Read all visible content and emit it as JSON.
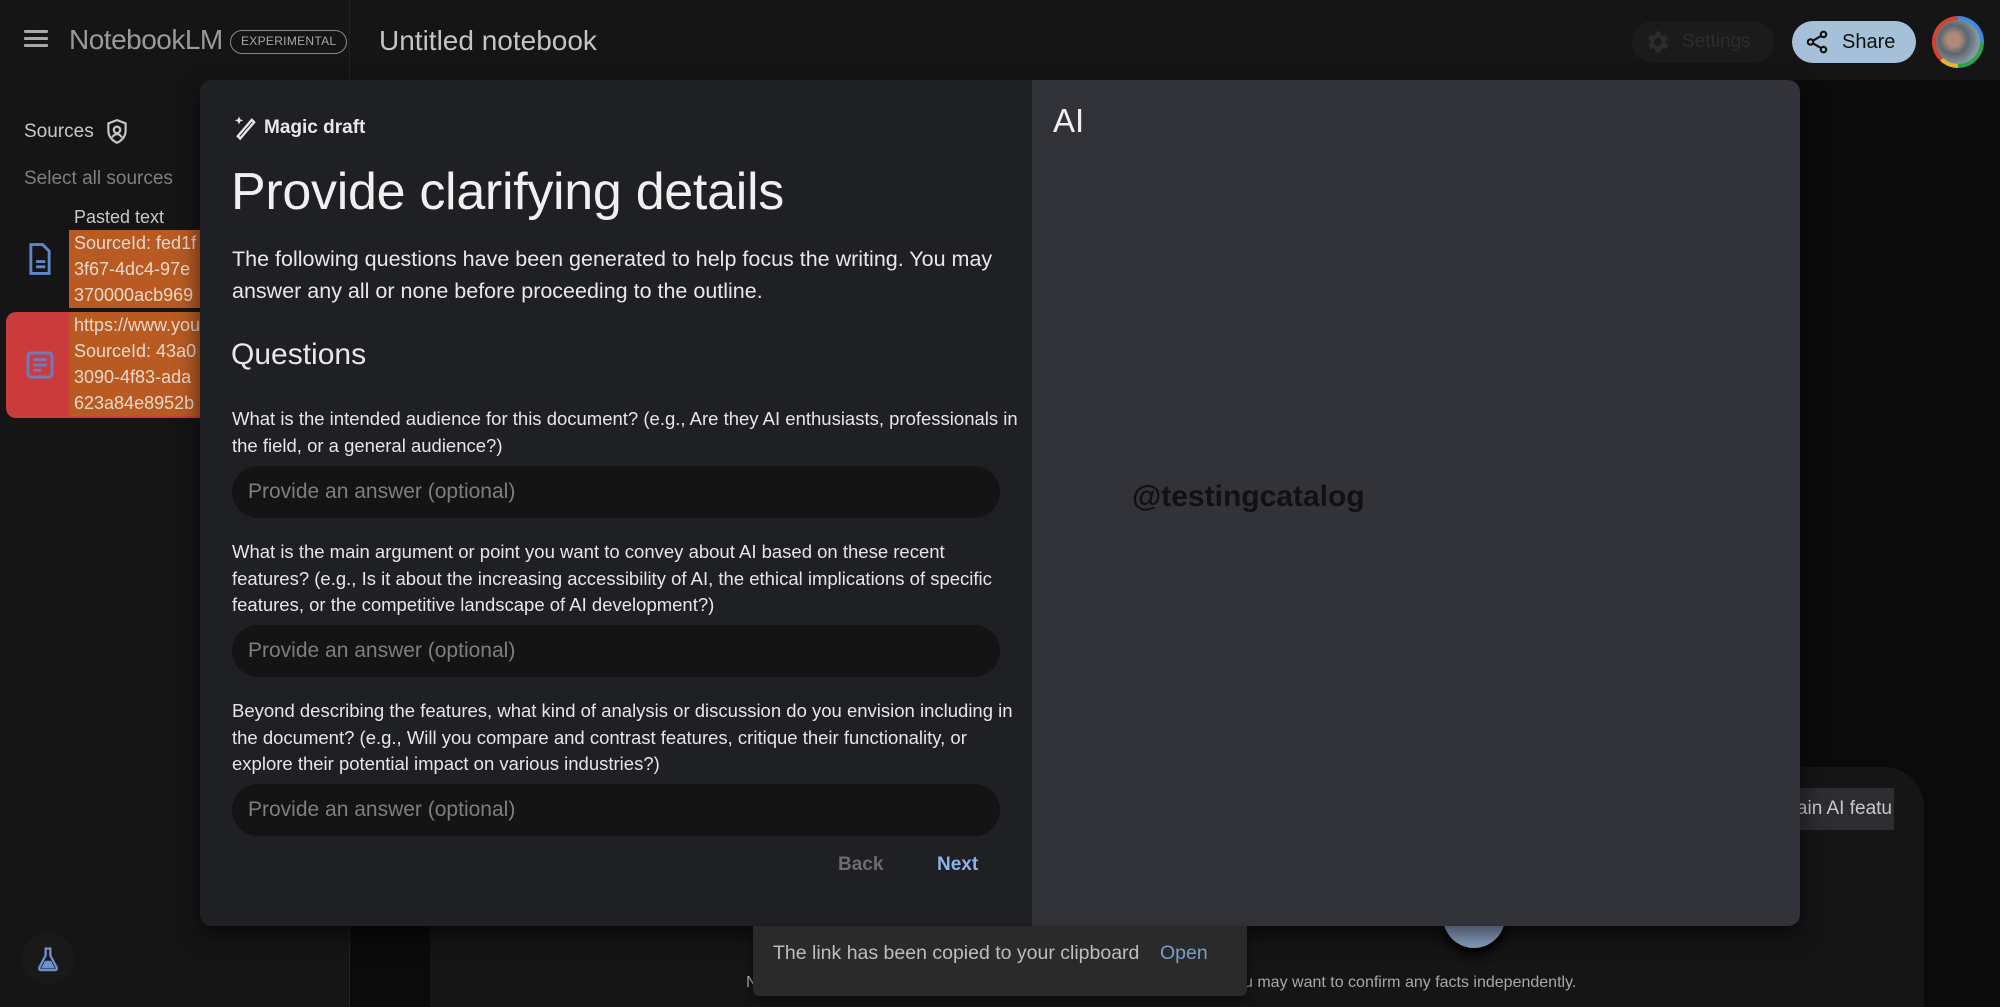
{
  "app": {
    "name": "NotebookLM",
    "badge": "EXPERIMENTAL",
    "notebook_title": "Untitled notebook"
  },
  "header": {
    "settings_label": "Settings",
    "share_label": "Share",
    "icons": {
      "menu": "hamburger-menu-icon",
      "settings": "gear-icon",
      "share": "share-icon",
      "avatar": "user-avatar"
    }
  },
  "sidebar": {
    "title": "Sources",
    "title_icon": "shield-icon",
    "select_all": "Select all sources",
    "sources": [
      {
        "title": "Pasted text",
        "icon": "document-icon",
        "lines": [
          "SourceId: fed1f",
          "3f67-4dc4-97e",
          "370000acb969"
        ]
      },
      {
        "title": "",
        "icon": "article-icon",
        "lines": [
          "https://www.you",
          "SourceId: 43a0",
          "3090-4f83-ada",
          "623a84e8952b"
        ]
      }
    ],
    "labs_icon": "flask-icon"
  },
  "modal": {
    "label": "Magic draft",
    "label_icon": "magic-wand-icon",
    "heading": "Provide clarifying details",
    "description": "The following questions have been generated to help focus the writing. You may answer any all or none before proceeding to the outline.",
    "questions_heading": "Questions",
    "questions": [
      {
        "text": "What is the intended audience for this document? (e.g., Are they AI enthusiasts, professionals in the field, or a general audience?)",
        "value": "",
        "placeholder": "Provide an answer (optional)"
      },
      {
        "text": "What is the main argument or point you want to convey about AI based on these recent features? (e.g., Is it about the increasing accessibility of AI, the ethical implications of specific features, or the competitive landscape of AI development?)",
        "value": "",
        "placeholder": "Provide an answer (optional)"
      },
      {
        "text": "Beyond describing the features, what kind of analysis or discussion do you envision including in the document? (e.g., Will you compare and contrast features, critique their functionality, or explore their potential impact on various industries?)",
        "value": "",
        "placeholder": "Provide an answer (optional)"
      }
    ],
    "back_label": "Back",
    "next_label": "Next",
    "preview_title": "AI",
    "watermark": "@testingcatalog"
  },
  "background": {
    "chat_chip_text": "ain AI featu",
    "disclaimer_left": "N",
    "disclaimer_right": "u may want to confirm any facts independently."
  },
  "toast": {
    "message": "The link has been copied to your clipboard",
    "action": "Open"
  },
  "colors": {
    "accent_blue": "#8fb2e8",
    "share_button": "#a5c0d8",
    "selected_source": "#cc3b3c",
    "highlight": "#b85a22"
  }
}
